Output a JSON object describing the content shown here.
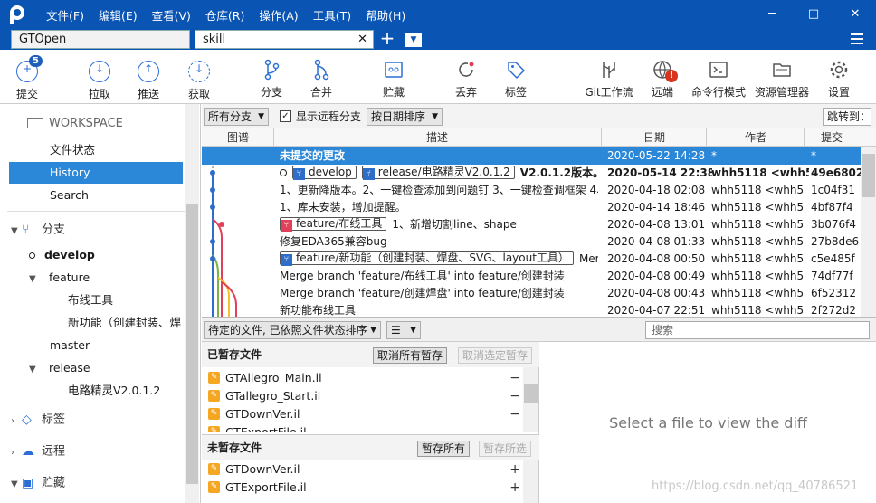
{
  "titlebar": {
    "menus": [
      "文件(F)",
      "编辑(E)",
      "查看(V)",
      "仓库(R)",
      "操作(A)",
      "工具(T)",
      "帮助(H)"
    ],
    "minimize": "─",
    "maximize": "□",
    "close": "✕"
  },
  "tabs": [
    {
      "label": "GTOpen"
    },
    {
      "label": "skill",
      "close": "✕"
    }
  ],
  "tab_add": "+",
  "tab_dropdown": "▼",
  "toolbar": {
    "commit": "提交",
    "commit_badge": "5",
    "pull": "拉取",
    "push": "推送",
    "fetch": "获取",
    "branch": "分支",
    "merge": "合并",
    "stash": "贮藏",
    "discard": "丢弃",
    "tag": "标签",
    "gitflow": "Git工作流",
    "remote": "远端",
    "remote_warn": "!",
    "terminal": "命令行模式",
    "explorer": "资源管理器",
    "settings": "设置"
  },
  "sidebar": {
    "workspace": "WORKSPACE",
    "file_status": "文件状态",
    "history": "History",
    "search": "Search",
    "branches": "分支",
    "branch_items": [
      "develop",
      "feature",
      "布线工具",
      "新功能（创建封装、焊",
      "master",
      "release",
      "电路精灵V2.0.1.2"
    ],
    "tags": "标签",
    "remotes": "远程",
    "stashes": "贮藏"
  },
  "logbar": {
    "all_branches": "所有分支",
    "show_remote": "显示远程分支",
    "sort": "按日期排序",
    "jump": "跳转到："
  },
  "table": {
    "headers": {
      "graph": "图谱",
      "desc": "描述",
      "date": "日期",
      "author": "作者",
      "commit": "提交"
    },
    "rows": [
      {
        "desc": "未提交的更改",
        "date": "2020-05-22 14:28",
        "author": "*",
        "sha": "*"
      },
      {
        "ref1": "develop",
        "ref2": "release/电路精灵V2.0.1.2",
        "desc": "V2.0.1.2版本。",
        "date": "2020-05-14 22:38",
        "author": "whh5118 <whh5",
        "sha": "49e6802"
      },
      {
        "desc": "1、更新降版本。2、一键检查添加到问题钉 3、一键检查调框架 4、",
        "date": "2020-04-18 02:08",
        "author": "whh5118 <whh5",
        "sha": "1c04f31"
      },
      {
        "desc": "1、库未安装，增加提醒。",
        "date": "2020-04-14 18:46",
        "author": "whh5118 <whh5",
        "sha": "4bf87f4"
      },
      {
        "ref1": "feature/布线工具",
        "desc": "1、新增切割line、shape",
        "date": "2020-04-08 13:01",
        "author": "whh5118 <whh5",
        "sha": "3b076f4"
      },
      {
        "desc": "修复EDA365兼容bug",
        "date": "2020-04-08 01:33",
        "author": "whh5118 <whh5",
        "sha": "27b8de6"
      },
      {
        "ref1": "feature/新功能（创建封装、焊盘、SVG、layout工具）",
        "desc": "Merge",
        "date": "2020-04-08 00:50",
        "author": "whh5118 <whh5",
        "sha": "c5e485f"
      },
      {
        "desc": "Merge branch 'feature/布线工具' into feature/创建封装",
        "date": "2020-04-08 00:49",
        "author": "whh5118 <whh5",
        "sha": "74df77f"
      },
      {
        "desc": "Merge branch 'feature/创建焊盘' into feature/创建封装",
        "date": "2020-04-08 00:43",
        "author": "whh5118 <whh5",
        "sha": "6f52312"
      },
      {
        "desc": "新功能布线工具",
        "date": "2020-04-07 22:51",
        "author": "whh5118 <whh5",
        "sha": "2f272d2"
      }
    ]
  },
  "stagebar": {
    "pending": "待定的文件, 已依照文件状态排序",
    "view": "☰",
    "search_placeholder": "搜索"
  },
  "staged": {
    "title": "已暂存文件",
    "unstage_all": "取消所有暂存",
    "unstage_sel": "取消选定暂存",
    "files": [
      "GTAllegro_Main.il",
      "GTallegro_Start.il",
      "GTDownVer.il",
      "GTExportFile.il"
    ]
  },
  "unstaged": {
    "title": "未暂存文件",
    "stage_all": "暂存所有",
    "stage_sel": "暂存所选",
    "files": [
      "GTDownVer.il",
      "GTExportFile.il"
    ]
  },
  "diff": {
    "message": "Select a file to view the diff"
  },
  "watermark": "https://blog.csdn.net/qq_40786521",
  "colors": {
    "brand": "#0a54b4",
    "selection": "#2b87d8",
    "graph_blue": "#2f6ec8",
    "graph_red": "#e0405a"
  }
}
